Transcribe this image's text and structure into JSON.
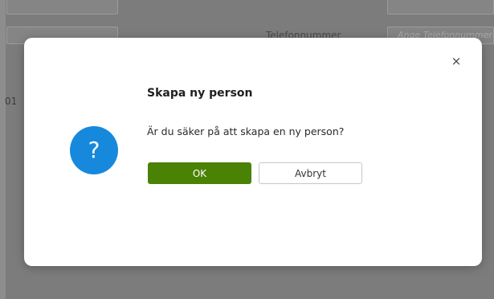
{
  "background": {
    "phone_label": "Telefonnummer",
    "phone_placeholder": "Ange Telefonnummer",
    "partial_value": "01"
  },
  "dialog": {
    "title": "Skapa ny person",
    "message": "Är du säker på att skapa en ny person?",
    "icon": "question-icon",
    "icon_glyph": "?",
    "close_glyph": "×",
    "ok_label": "OK",
    "cancel_label": "Avbryt"
  },
  "colors": {
    "overlay": "#7c7c7c",
    "ok_button": "#498205",
    "icon": "#1789dc"
  }
}
